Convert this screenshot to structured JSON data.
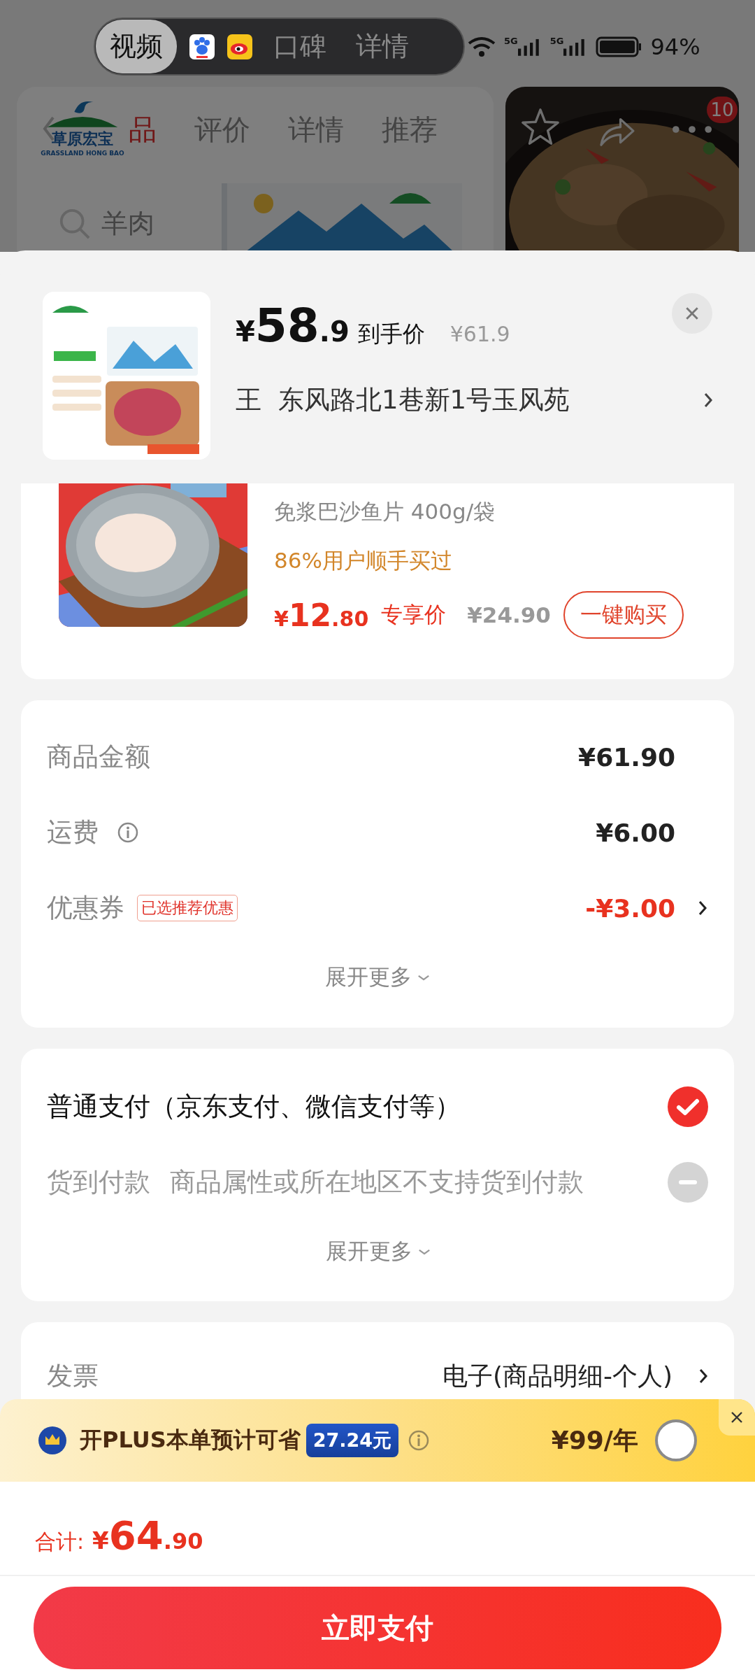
{
  "status_bar": {
    "signals": [
      {
        "label": "5G"
      },
      {
        "label": "5G"
      }
    ],
    "battery": "94%"
  },
  "media_tabs": [
    {
      "label": "视频",
      "selected": true
    },
    {
      "label": "口碑",
      "selected": false
    },
    {
      "label": "详情",
      "selected": false
    }
  ],
  "background_page": {
    "tabs": [
      {
        "label": "品",
        "selected": true
      },
      {
        "label": "评价",
        "selected": false
      },
      {
        "label": "详情",
        "selected": false
      },
      {
        "label": "推荐",
        "selected": false
      }
    ],
    "search": {
      "placeholder": "羊肉"
    },
    "logo": {
      "name": "草原宏宝",
      "subtitle": "GRASSLAND HONG BAO"
    },
    "cart_badge": "10"
  },
  "header": {
    "price": {
      "symbol": "¥",
      "integer": "58",
      "decimal": ".9"
    },
    "price_label": "到手价",
    "original_price": "¥61.9",
    "recipient": "王",
    "address": "东风路北1巷新1号玉风苑"
  },
  "recommended_item": {
    "name": "免浆巴沙鱼片 400g/袋",
    "social_proof": "86%用户顺手买过",
    "price": {
      "symbol": "¥",
      "integer": "12",
      "decimal": ".80"
    },
    "price_label": "专享价",
    "original_price": "¥24.90",
    "button": "一键购买"
  },
  "summary": {
    "rows": [
      {
        "kind": "plain",
        "label": "商品金额",
        "value": "¥61.90"
      },
      {
        "kind": "info",
        "label": "运费",
        "value": "¥6.00"
      },
      {
        "kind": "discount",
        "label": "优惠券",
        "tag": "已选推荐优惠",
        "value": "-¥3.00"
      }
    ],
    "expand": "展开更多"
  },
  "payment": {
    "options": [
      {
        "label": "普通支付（京东支付、微信支付等）",
        "selected": true,
        "disabled": false
      },
      {
        "label": "货到付款",
        "note": "商品属性或所在地区不支持货到付款",
        "selected": false,
        "disabled": true
      }
    ],
    "expand": "展开更多"
  },
  "invoice": {
    "label": "发票",
    "value": "电子(商品明细-个人)"
  },
  "plus_banner": {
    "text": "开PLUS本单预计可省",
    "saving": "27.24元",
    "price": "¥99/年",
    "selected": false
  },
  "footer": {
    "total_label": "合计:",
    "total": {
      "symbol": "¥",
      "integer": "64",
      "decimal": ".90"
    },
    "pay_button": "立即支付"
  }
}
